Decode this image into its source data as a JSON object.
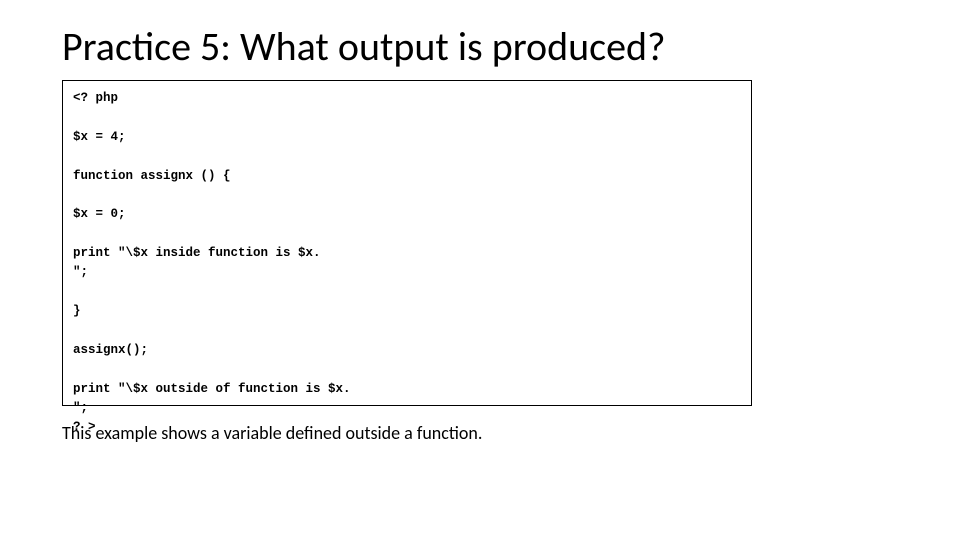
{
  "title": "Practice 5: What output is produced?",
  "code": "<? php\n\n$x = 4;\n\nfunction assignx () {\n\n$x = 0;\n\nprint \"\\$x inside function is $x.\n\";\n\n}\n\nassignx();\n\nprint \"\\$x outside of function is $x.\n\";\n? >",
  "caption": "This example shows a variable defined outside a function."
}
